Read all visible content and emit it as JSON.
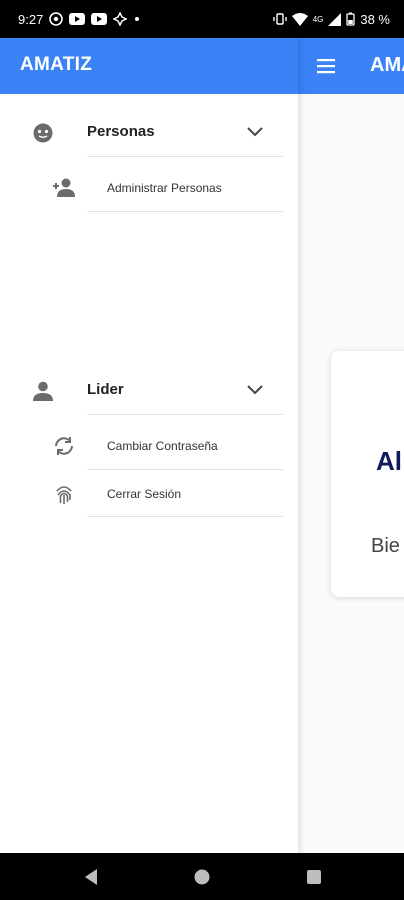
{
  "status_bar": {
    "time": "9:27",
    "battery": "38 %",
    "network": "4G"
  },
  "background_app": {
    "title": "AMA",
    "card_title": "Al",
    "card_text": "Bie"
  },
  "drawer": {
    "title": "AMATIZ",
    "groups": [
      {
        "label": "Personas",
        "icon": "face-icon",
        "items": [
          {
            "label": "Administrar Personas",
            "icon": "person-add-icon"
          }
        ]
      },
      {
        "label": "Lider",
        "icon": "person-icon",
        "items": [
          {
            "label": "Cambiar Contraseña",
            "icon": "sync-icon"
          },
          {
            "label": "Cerrar Sesión",
            "icon": "fingerprint-icon"
          }
        ]
      }
    ]
  },
  "colors": {
    "primary": "#3b82f6",
    "icon_gray": "#6b6b6b",
    "divider": "#e2e2e2"
  }
}
